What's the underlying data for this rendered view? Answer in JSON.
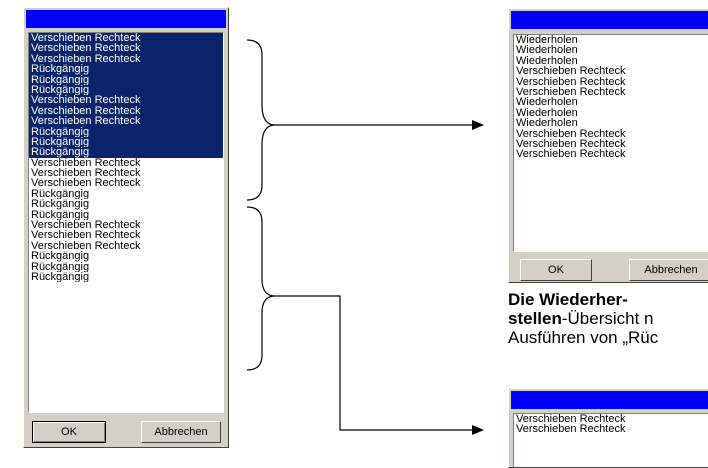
{
  "left_dialog": {
    "list_items": [
      {
        "label": "Verschieben Rechteck",
        "selected": true
      },
      {
        "label": "Verschieben Rechteck",
        "selected": true
      },
      {
        "label": "Verschieben Rechteck",
        "selected": true
      },
      {
        "label": "Rückgängig",
        "selected": true
      },
      {
        "label": "Rückgängig",
        "selected": true
      },
      {
        "label": "Rückgängig",
        "selected": true
      },
      {
        "label": "Verschieben Rechteck",
        "selected": true
      },
      {
        "label": "Verschieben Rechteck",
        "selected": true
      },
      {
        "label": "Verschieben Rechteck",
        "selected": true
      },
      {
        "label": "Rückgängig",
        "selected": true
      },
      {
        "label": "Rückgängig",
        "selected": true
      },
      {
        "label": "Rückgängig",
        "selected": true
      },
      {
        "label": "Verschieben Rechteck",
        "selected": false
      },
      {
        "label": "Verschieben Rechteck",
        "selected": false
      },
      {
        "label": "Verschieben Rechteck",
        "selected": false
      },
      {
        "label": "Rückgängig",
        "selected": false
      },
      {
        "label": "Rückgängig",
        "selected": false
      },
      {
        "label": "Rückgängig",
        "selected": false
      },
      {
        "label": "Verschieben Rechteck",
        "selected": false
      },
      {
        "label": "Verschieben Rechteck",
        "selected": false
      },
      {
        "label": "Verschieben Rechteck",
        "selected": false
      },
      {
        "label": "Rückgängig",
        "selected": false
      },
      {
        "label": "Rückgängig",
        "selected": false
      },
      {
        "label": "Rückgängig",
        "selected": false
      }
    ],
    "ok_label": "OK",
    "cancel_label": "Abbrechen"
  },
  "right_dialog": {
    "list_items": [
      "Wiederholen",
      "Wiederholen",
      "Wiederholen",
      "Verschieben Rechteck",
      "Verschieben Rechteck",
      "Verschieben Rechteck",
      "Wiederholen",
      "Wiederholen",
      "Wiederholen",
      "Verschieben Rechteck",
      "Verschieben Rechteck",
      "Verschieben Rechteck"
    ],
    "ok_label": "OK",
    "cancel_label": "Abbrechen"
  },
  "bottom_dialog": {
    "list_items": [
      "Verschieben Rechteck",
      "Verschieben Rechteck"
    ]
  },
  "caption": {
    "line1_bold": "Die Wiederher-",
    "line2_bold": "stellen",
    "line2_rest": "-Übersicht n",
    "line3": "Ausführen von „Rüc"
  },
  "colors": {
    "title_bar": "#0000ff",
    "selection": "#0a246a",
    "dialog_face": "#d4d0c8"
  }
}
